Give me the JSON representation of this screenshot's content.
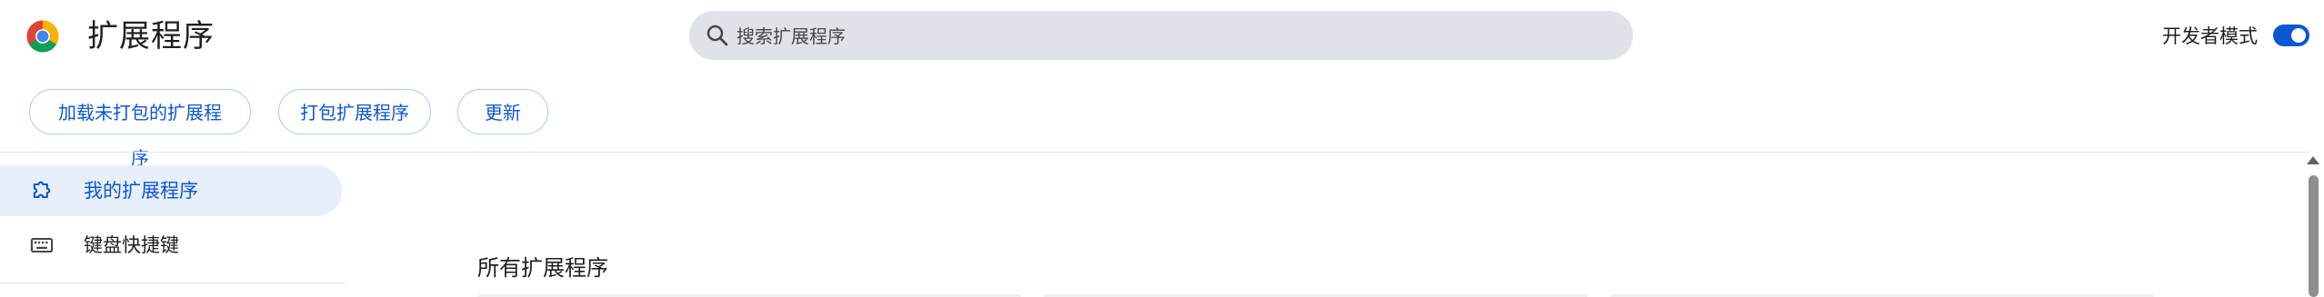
{
  "header": {
    "title": "扩展程序",
    "logo_icon": "chrome-logo-icon",
    "search": {
      "placeholder": "搜索扩展程序",
      "value": "",
      "icon": "search-icon"
    },
    "dev_mode": {
      "label": "开发者模式",
      "enabled": true
    }
  },
  "toolbar": {
    "load_unpacked_label": "加载未打包的扩展程序",
    "pack_label": "打包扩展程序",
    "update_label": "更新"
  },
  "sidebar": {
    "items": [
      {
        "label": "我的扩展程序",
        "icon": "puzzle-piece-icon",
        "active": true
      },
      {
        "label": "键盘快捷键",
        "icon": "keyboard-icon",
        "active": false
      }
    ]
  },
  "main": {
    "section_title": "所有扩展程序"
  },
  "colors": {
    "accent": "#0b57d0",
    "search_bg": "#dfe2e8",
    "active_bg": "#e8effc",
    "button_border": "#a8c7fa"
  }
}
